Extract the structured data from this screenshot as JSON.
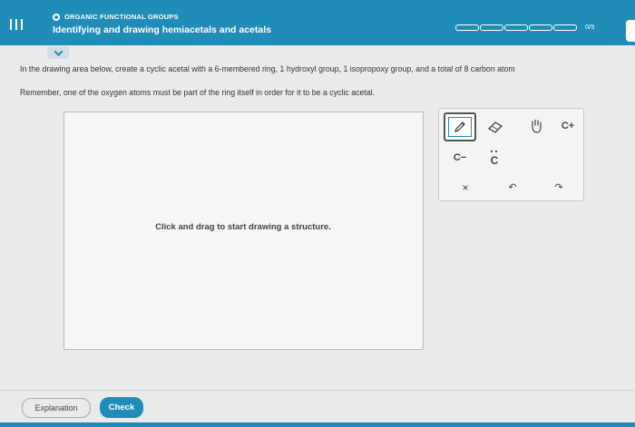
{
  "header": {
    "topic": "ORGANIC FUNCTIONAL GROUPS",
    "title": "Identifying and drawing hemiacetals and acetals",
    "progress_label": "0/5",
    "progress_segments": 5,
    "progress_completed": 0
  },
  "instructions": {
    "line1": "In the drawing area below, create a cyclic acetal with a 6-membered ring, 1 hydroxyl group, 1 isopropoxy group, and a total of 8 carbon atom",
    "line2": "Remember, one of the oxygen atoms must be part of the ring itself in order for it to be a cyclic acetal."
  },
  "canvas": {
    "prompt": "Click and drag to start drawing a structure."
  },
  "toolbox": {
    "c_plus": "C+",
    "c_minus": "C−",
    "c_radical": "C",
    "x_label": "×",
    "undo": "↶",
    "redo": "↷"
  },
  "footer": {
    "explanation_label": "Explanation",
    "check_label": "Check"
  },
  "colors": {
    "brand": "#1f8db8",
    "background": "#e9eaec"
  }
}
